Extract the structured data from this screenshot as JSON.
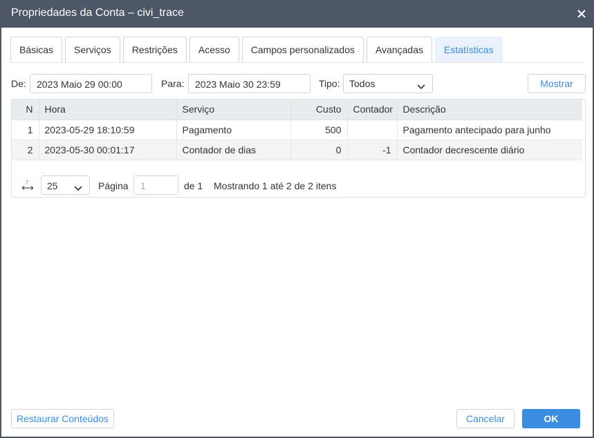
{
  "window": {
    "title": "Propriedades da Conta – civi_trace",
    "close_icon": "close-icon"
  },
  "tabs": [
    {
      "label": "Básicas"
    },
    {
      "label": "Serviços"
    },
    {
      "label": "Restrições"
    },
    {
      "label": "Acesso"
    },
    {
      "label": "Campos personalizados"
    },
    {
      "label": "Avançadas"
    },
    {
      "label": "Estatísticas",
      "active": true
    }
  ],
  "filters": {
    "from_label": "De:",
    "from_value": "2023 Maio 29 00:00",
    "to_label": "Para:",
    "to_value": "2023 Maio 30 23:59",
    "type_label": "Tipo:",
    "type_value": "Todos",
    "show_button": "Mostrar"
  },
  "table": {
    "columns": [
      "N",
      "Hora",
      "Serviço",
      "Custo",
      "Contador",
      "Descrição"
    ],
    "rows": [
      [
        "1",
        "2023-05-29 18:10:59",
        "Pagamento",
        "500",
        "",
        "Pagamento antecipado para junho"
      ],
      [
        "2",
        "2023-05-30 00:01:17",
        "Contador de dias",
        "0",
        "-1",
        "Contador decrescente diário"
      ]
    ]
  },
  "pager": {
    "page_size": "25",
    "page_label": "Página",
    "page_value": "1",
    "of_label": "de 1",
    "info": "Mostrando 1 até 2 de 2 itens"
  },
  "footer": {
    "restore_button": "Restaurar Conteúdos",
    "cancel_button": "Cancelar",
    "ok_button": "OK"
  },
  "colors": {
    "titlebar": "#4e5767",
    "accent": "#3a8de0",
    "active_tab_bg": "#e8f1fc"
  }
}
